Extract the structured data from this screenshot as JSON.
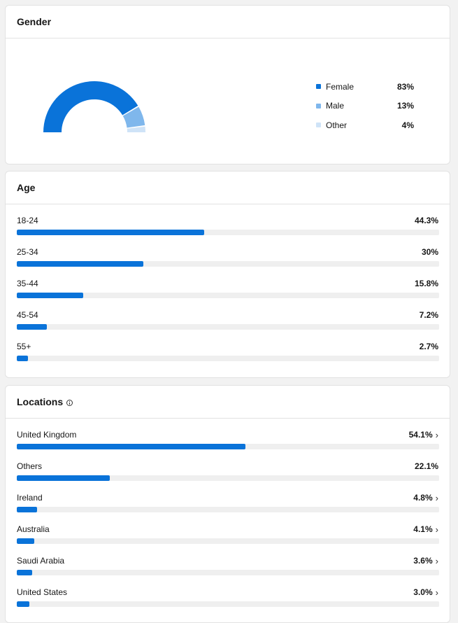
{
  "colors": {
    "female": "#0a73d9",
    "male": "#7fb7ec",
    "other": "#cfe3f7",
    "bar": "#0a73d9",
    "track": "#efefef"
  },
  "gender": {
    "title": "Gender",
    "items": [
      {
        "label": "Female",
        "value": "83%",
        "fraction": 0.83
      },
      {
        "label": "Male",
        "value": "13%",
        "fraction": 0.13
      },
      {
        "label": "Other",
        "value": "4%",
        "fraction": 0.04
      }
    ]
  },
  "age": {
    "title": "Age",
    "items": [
      {
        "label": "18-24",
        "value": "44.3%",
        "percent": 44.3
      },
      {
        "label": "25-34",
        "value": "30%",
        "percent": 30
      },
      {
        "label": "35-44",
        "value": "15.8%",
        "percent": 15.8
      },
      {
        "label": "45-54",
        "value": "7.2%",
        "percent": 7.2
      },
      {
        "label": "55+",
        "value": "2.7%",
        "percent": 2.7
      }
    ]
  },
  "locations": {
    "title": "Locations",
    "info_icon": "info-icon",
    "chevron_icon": "chevron-right-icon",
    "chevron_glyph": "›",
    "items": [
      {
        "label": "United Kingdom",
        "value": "54.1%",
        "percent": 54.1,
        "chevron": true
      },
      {
        "label": "Others",
        "value": "22.1%",
        "percent": 22.1,
        "chevron": false
      },
      {
        "label": "Ireland",
        "value": "4.8%",
        "percent": 4.8,
        "chevron": true
      },
      {
        "label": "Australia",
        "value": "4.1%",
        "percent": 4.1,
        "chevron": true
      },
      {
        "label": "Saudi Arabia",
        "value": "3.6%",
        "percent": 3.6,
        "chevron": true
      },
      {
        "label": "United States",
        "value": "3.0%",
        "percent": 3.0,
        "chevron": true
      }
    ]
  }
}
